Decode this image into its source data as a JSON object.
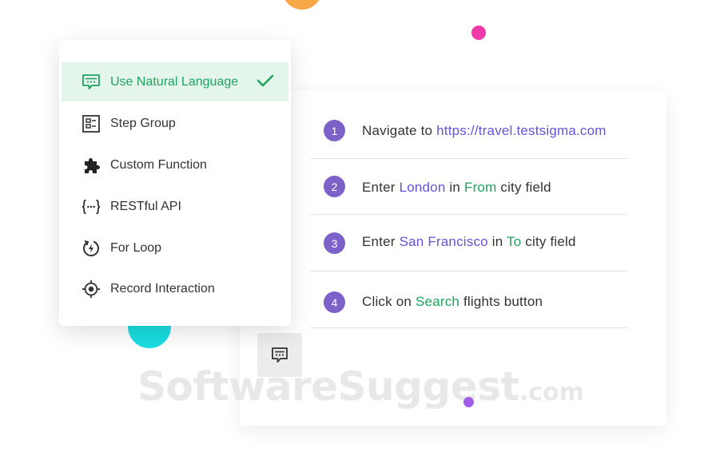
{
  "menu": {
    "items": [
      {
        "label": "Use Natural Language",
        "icon": "natural-language-icon",
        "selected": true
      },
      {
        "label": "Step Group",
        "icon": "step-group-icon",
        "selected": false
      },
      {
        "label": "Custom Function",
        "icon": "puzzle-icon",
        "selected": false
      },
      {
        "label": "RESTful API",
        "icon": "api-braces-icon",
        "selected": false
      },
      {
        "label": "For Loop",
        "icon": "loop-icon",
        "selected": false
      },
      {
        "label": "Record Interaction",
        "icon": "target-icon",
        "selected": false
      }
    ]
  },
  "steps": [
    {
      "number": "1",
      "parts": [
        "Navigate to ",
        "https://travel.testsigma.com"
      ]
    },
    {
      "number": "2",
      "parts": [
        "Enter ",
        "London",
        " in ",
        "From",
        " city field"
      ]
    },
    {
      "number": "3",
      "parts": [
        "Enter ",
        "San Francisco",
        " in ",
        "To",
        " city field"
      ]
    },
    {
      "number": "4",
      "parts": [
        "Click on ",
        "Search",
        " flights button"
      ]
    }
  ],
  "watermark": {
    "main": "SoftwareSuggest",
    "suffix": ".com"
  },
  "colors": {
    "accent_green": "#1fa35e",
    "accent_purple": "#6552d9",
    "step_badge": "#7b61c8",
    "active_bg": "#e4f5ec"
  }
}
